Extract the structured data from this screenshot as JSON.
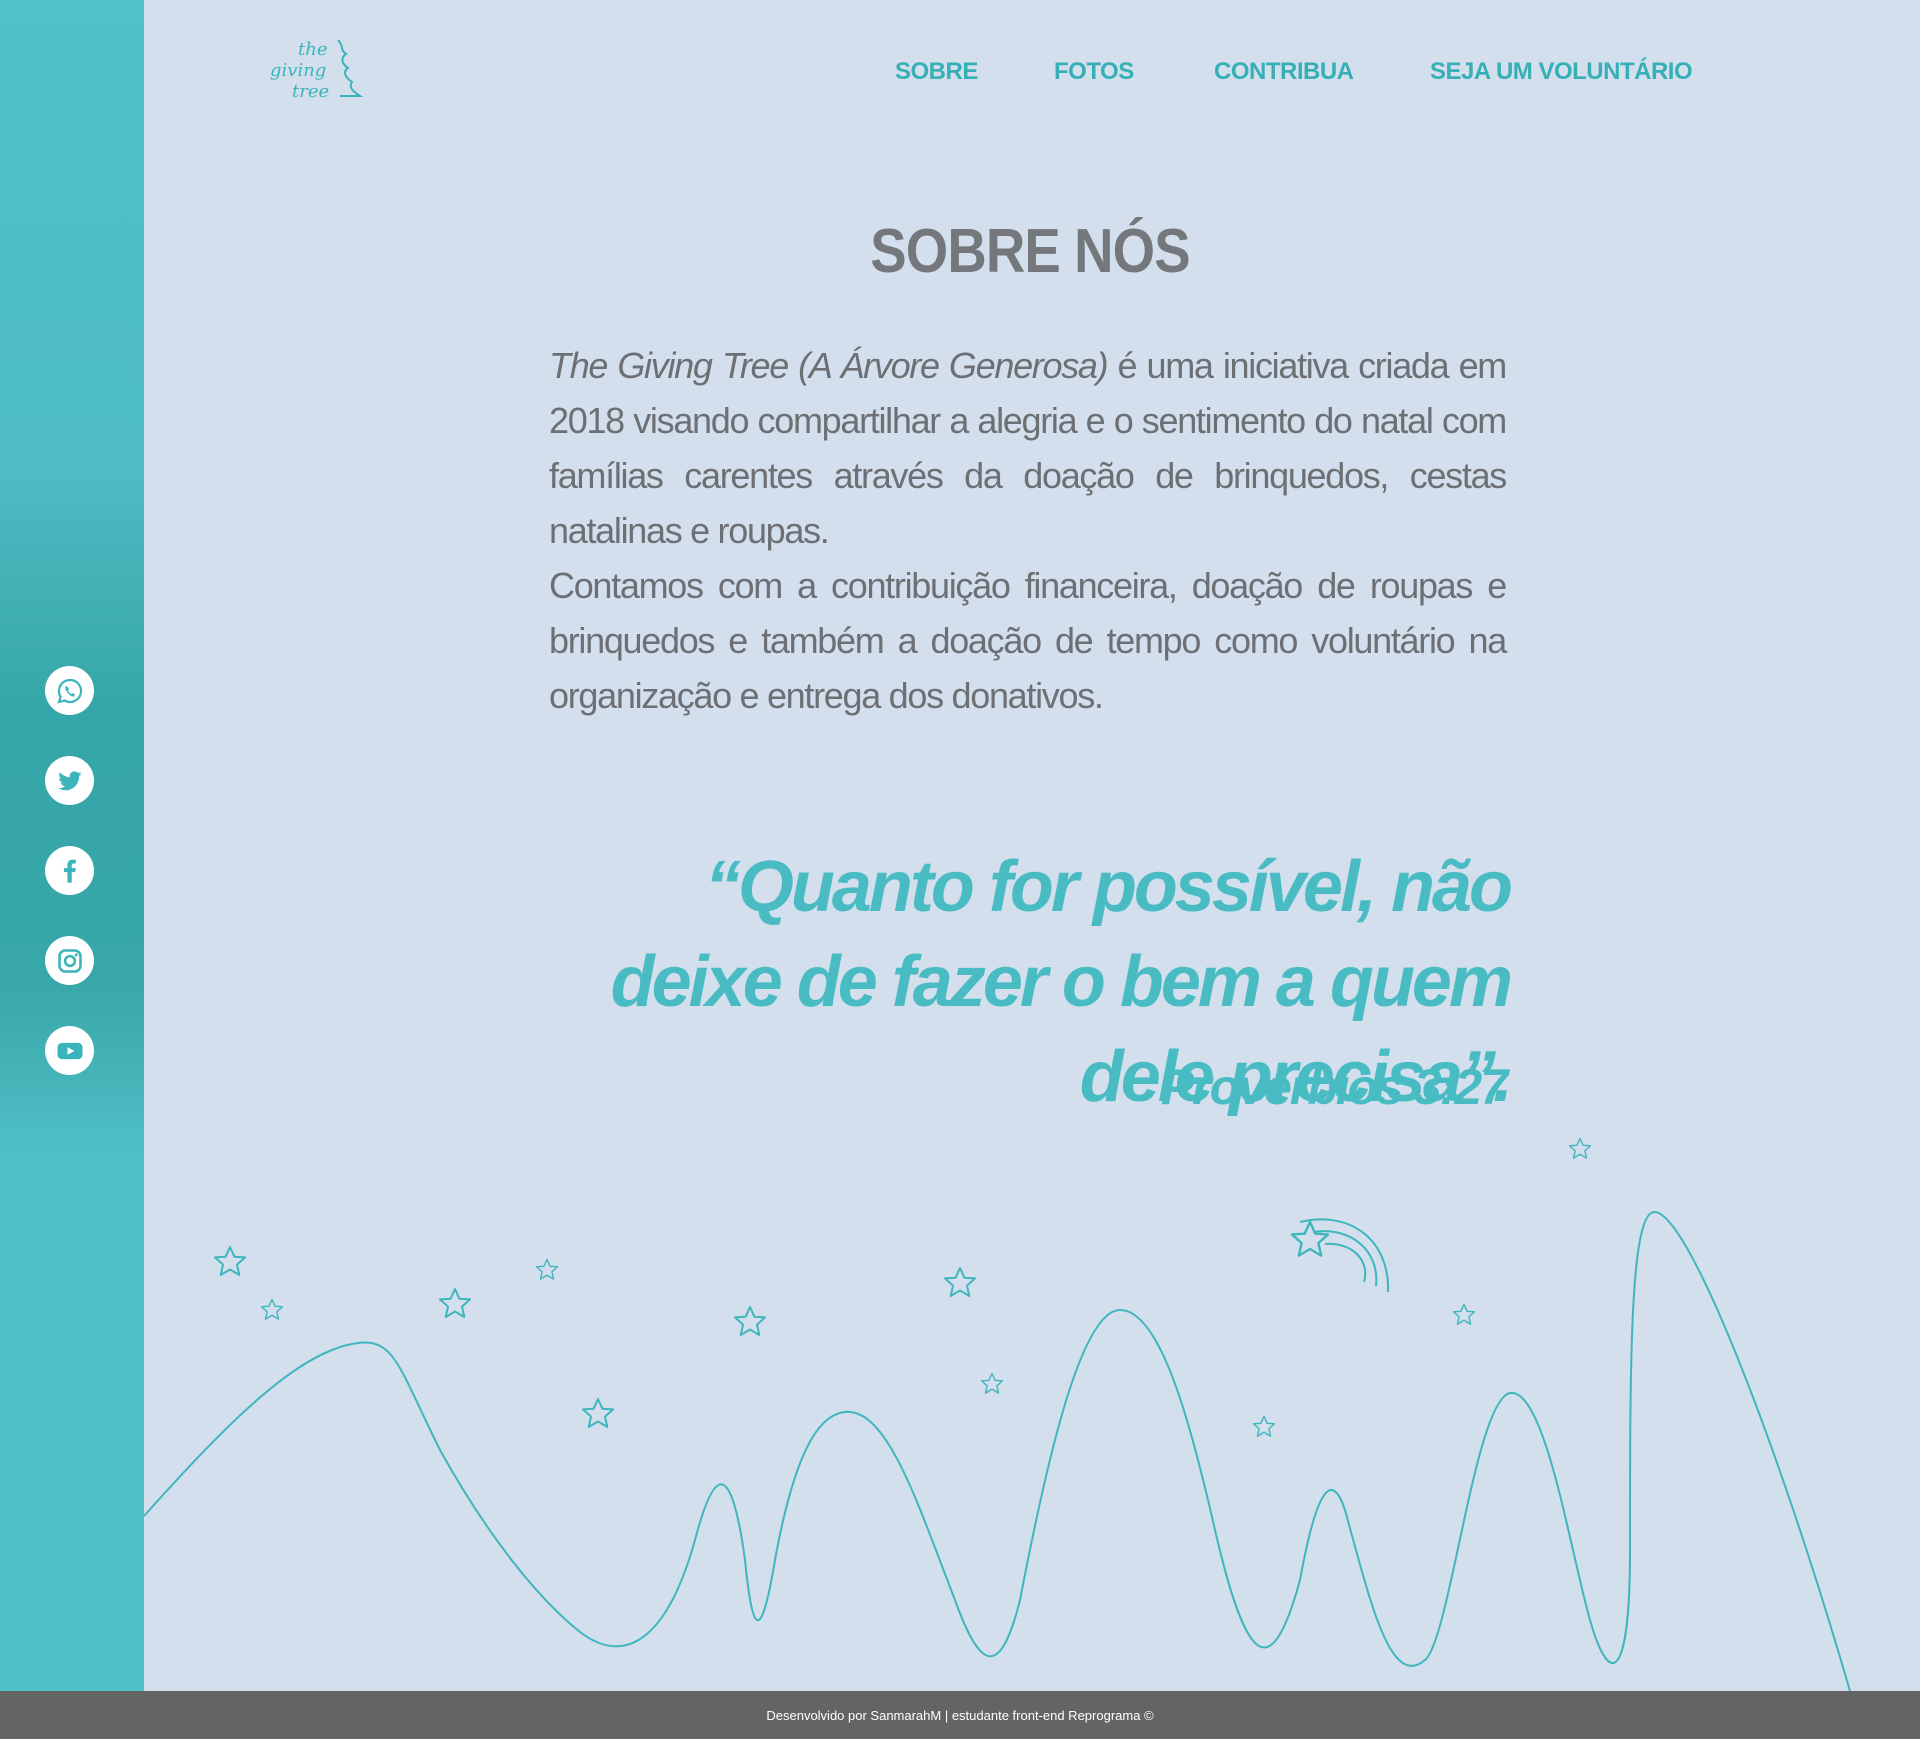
{
  "brand": {
    "logo_line1": "the",
    "logo_line2": "giving",
    "logo_line3": "tree"
  },
  "nav": {
    "items": [
      {
        "label": "SOBRE"
      },
      {
        "label": "FOTOS"
      },
      {
        "label": "CONTRIBUA"
      },
      {
        "label": "SEJA UM VOLUNTÁRIO"
      }
    ]
  },
  "about": {
    "title": "SOBRE NÓS",
    "p1_italic": "The Giving Tree (A Árvore Generosa)",
    "p1_rest": " é uma iniciativa criada em 2018 visando compartilhar a alegria e o sentimento do natal com famílias carentes através da doação de brinquedos, cestas natalinas e roupas.",
    "p2": "Contamos com a contribuição financeira, doação de roupas e brinquedos e também a doação de tempo como voluntário na organização e entrega dos donativos."
  },
  "quote": {
    "text": "“Quanto for possível, não deixe de fazer o bem a quem dele precisa”.",
    "reference": "Provérbios 3:27"
  },
  "social": [
    {
      "icon": "whatsapp-icon"
    },
    {
      "icon": "twitter-icon"
    },
    {
      "icon": "facebook-icon"
    },
    {
      "icon": "instagram-icon"
    },
    {
      "icon": "youtube-icon"
    }
  ],
  "footer": {
    "text": "Desenvolvido por SanmarahM | estudante front-end Reprograma ©"
  },
  "colors": {
    "accent": "#49bcc3",
    "sidebar": "#4fc1c8",
    "background": "#d3dfec",
    "text": "#6c6f73",
    "footer": "#646464"
  }
}
